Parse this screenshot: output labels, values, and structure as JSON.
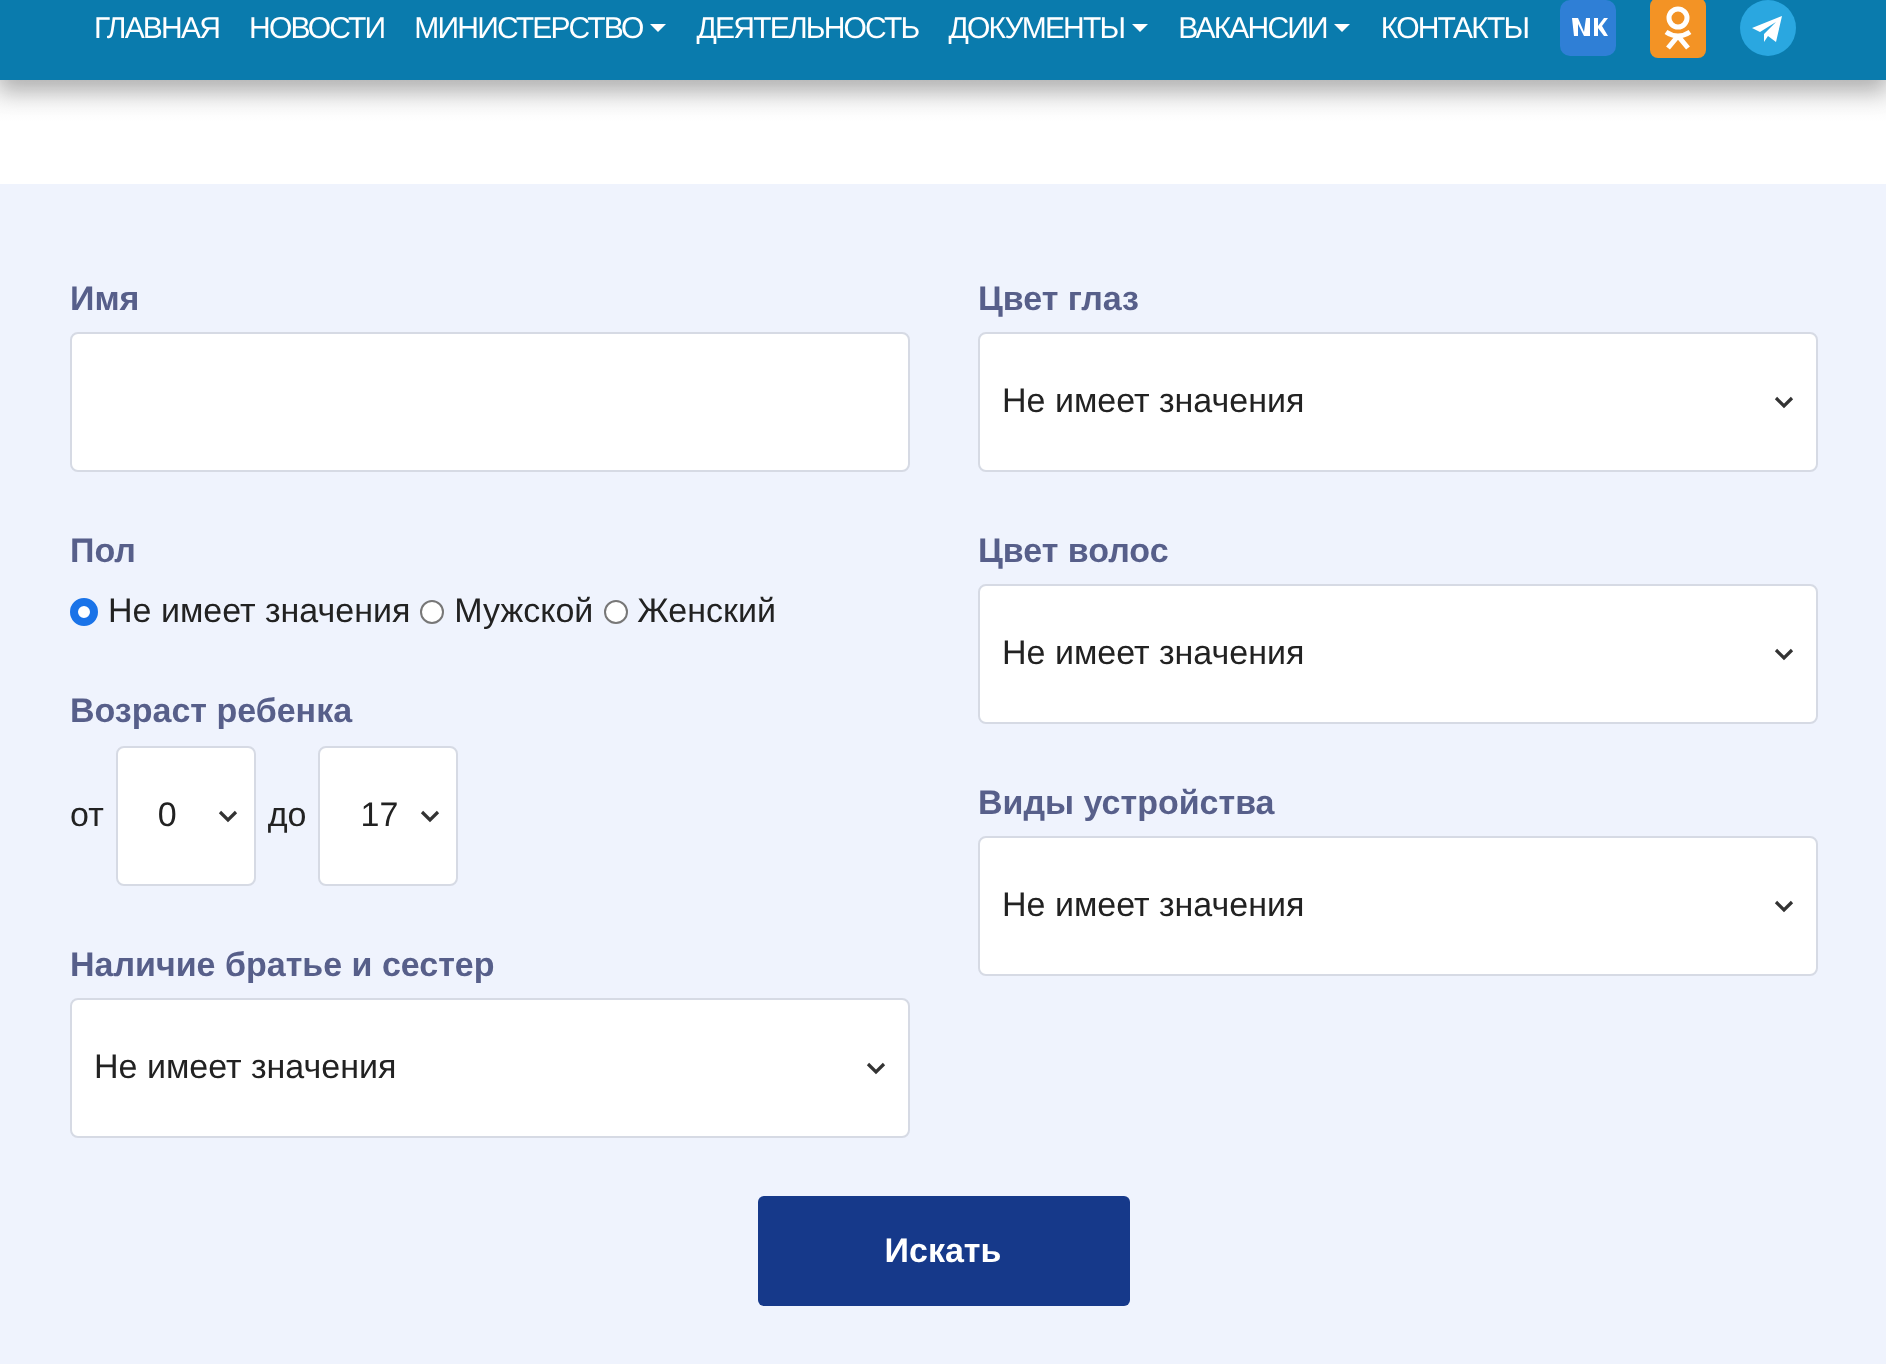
{
  "nav": {
    "items": [
      {
        "label": "ГЛАВНАЯ",
        "dropdown": false
      },
      {
        "label": "НОВОСТИ",
        "dropdown": false
      },
      {
        "label": "МИНИСТЕРСТВО",
        "dropdown": true
      },
      {
        "label": "ДЕЯТЕЛЬНОСТЬ",
        "dropdown": false
      },
      {
        "label": "ДОКУМЕНТЫ",
        "dropdown": true
      },
      {
        "label": "ВАКАНСИИ",
        "dropdown": true
      },
      {
        "label": "КОНТАКТЫ",
        "dropdown": false
      }
    ]
  },
  "form": {
    "left": [
      {
        "kind": "text",
        "label": "Имя"
      },
      {
        "kind": "radio",
        "label": "Пол",
        "options": [
          {
            "label": "Не имеет значения",
            "selected": true
          },
          {
            "label": "Мужской",
            "selected": false
          },
          {
            "label": "Женский",
            "selected": false
          }
        ]
      },
      {
        "kind": "range",
        "label": "Возраст ребенка",
        "from_label": "от",
        "from_value": "0",
        "to_label": "до",
        "to_value": "17"
      },
      {
        "kind": "select",
        "label": "Наличие братье и сестер",
        "value": "Не имеет значения"
      }
    ],
    "right": [
      {
        "kind": "select",
        "label": "Цвет глаз",
        "value": "Не имеет значения"
      },
      {
        "kind": "select",
        "label": "Цвет волос",
        "value": "Не имеет значения"
      },
      {
        "kind": "select",
        "label": "Виды устройства",
        "value": "Не имеет значения"
      }
    ],
    "button": "Искать"
  }
}
